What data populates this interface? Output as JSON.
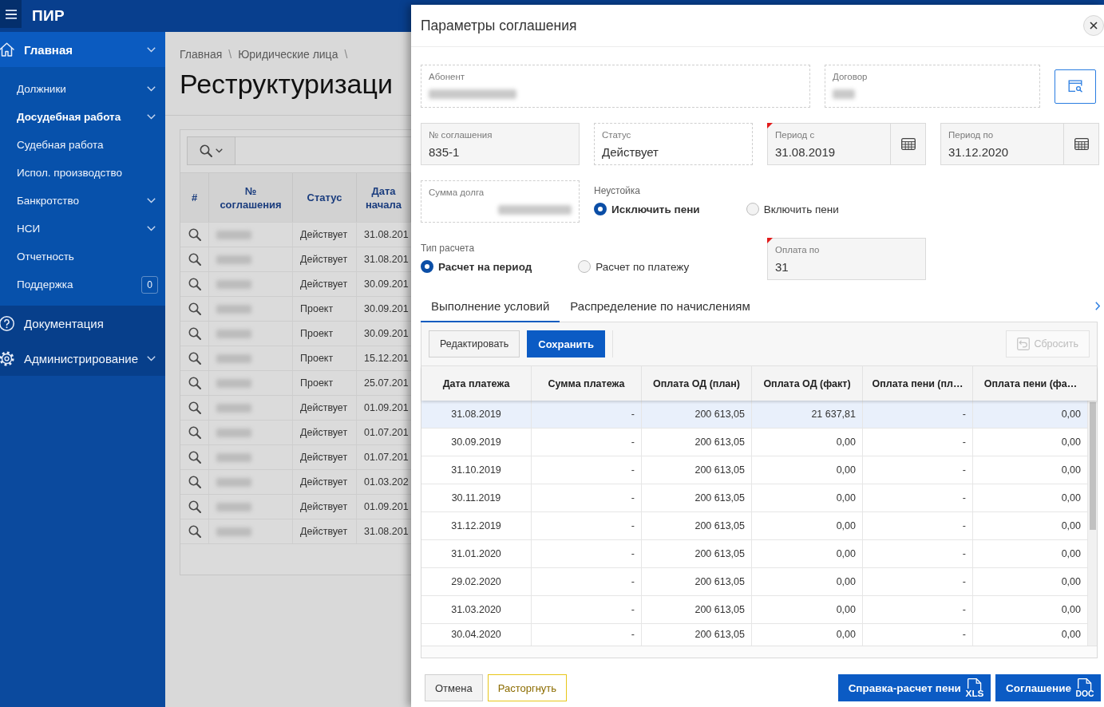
{
  "header": {
    "app_title": "ПИР"
  },
  "sidebar": {
    "home": {
      "label": "Главная",
      "selected": true,
      "expanded": true,
      "has_submenu": true,
      "children": [
        {
          "label": "Должники",
          "selected": false,
          "has_submenu": true
        },
        {
          "label": "Досудебная работа",
          "selected": true,
          "has_submenu": true
        },
        {
          "label": "Судебная работа",
          "selected": false,
          "has_submenu": false
        },
        {
          "label": "Испол. производство",
          "selected": false,
          "has_submenu": false
        },
        {
          "label": "Банкротство",
          "selected": false,
          "has_submenu": true
        },
        {
          "label": "НСИ",
          "selected": false,
          "has_submenu": true
        },
        {
          "label": "Отчетность",
          "selected": false,
          "has_submenu": false
        },
        {
          "label": "Поддержка",
          "selected": false,
          "has_submenu": false,
          "badge": "0"
        }
      ]
    },
    "documentation": {
      "label": "Документация",
      "selected": false
    },
    "administration": {
      "label": "Администрирование",
      "selected": false,
      "has_submenu": true
    }
  },
  "page": {
    "breadcrumb": [
      {
        "label": "Главная",
        "separator": "\\"
      },
      {
        "label": "Юридические лица",
        "separator": "\\"
      }
    ],
    "title": "Реструктуризаци",
    "table": {
      "columns": [
        "#",
        "№ соглашения",
        "Статус",
        "Дата начала"
      ],
      "rows": [
        {
          "status": "Действует",
          "start_date": "31.08.201"
        },
        {
          "status": "Действует",
          "start_date": "31.08.201"
        },
        {
          "status": "Действует",
          "start_date": "30.09.201"
        },
        {
          "status": "Проект",
          "start_date": "30.09.201"
        },
        {
          "status": "Проект",
          "start_date": "30.09.201"
        },
        {
          "status": "Проект",
          "start_date": "15.12.201"
        },
        {
          "status": "Проект",
          "start_date": "25.07.201"
        },
        {
          "status": "Действует",
          "start_date": "01.09.201"
        },
        {
          "status": "Действует",
          "start_date": "01.07.201"
        },
        {
          "status": "Действует",
          "start_date": "01.07.201"
        },
        {
          "status": "Действует",
          "start_date": "01.03.202"
        },
        {
          "status": "Действует",
          "start_date": "01.09.201"
        },
        {
          "status": "Действует",
          "start_date": "31.08.201"
        }
      ]
    }
  },
  "dialog": {
    "title": "Параметры соглашения",
    "form": [
      [
        {
          "kind": "readonly",
          "label": "Абонент",
          "blurred": true,
          "required": false
        },
        {
          "kind": "readonly",
          "label": "Договор",
          "blurred": true,
          "required": false
        },
        {
          "kind": "lookup_button"
        }
      ],
      [
        {
          "kind": "input",
          "label": "№ соглашения",
          "value": "835-1",
          "required": false
        },
        {
          "kind": "readonly",
          "label": "Статус",
          "value": "Действует",
          "blurred": false,
          "required": false
        },
        {
          "kind": "date",
          "label": "Период с",
          "value": "31.08.2019",
          "required": true
        },
        {
          "kind": "date",
          "label": "Период по",
          "value": "31.12.2020",
          "required": false
        }
      ],
      [
        {
          "kind": "amount",
          "label": "Сумма долга",
          "blurred": true,
          "required": false
        },
        {
          "kind": "radio_group",
          "label": "Неустойка",
          "options": [
            {
              "label": "Исключить пени",
              "selected": true
            },
            {
              "label": "Включить пени",
              "selected": false
            }
          ]
        }
      ],
      [
        {
          "kind": "radio_group",
          "label": "Тип расчета",
          "options": [
            {
              "label": "Расчет на период",
              "selected": true
            },
            {
              "label": "Расчет по платежу",
              "selected": false
            }
          ]
        },
        {
          "kind": "input",
          "label": "Оплата по",
          "value": "31",
          "required": true
        }
      ]
    ],
    "tabs": [
      {
        "label": "Выполнение условий",
        "selected": true
      },
      {
        "label": "Распределение по начислениям",
        "selected": false
      }
    ],
    "grid": {
      "toolbar": [
        {
          "label": "Редактировать",
          "kind": "default",
          "disabled": false
        },
        {
          "label": "Сохранить",
          "kind": "primary",
          "disabled": false
        },
        {
          "label": "Сбросить",
          "kind": "reset",
          "disabled": true
        }
      ],
      "columns": [
        "Дата платежа",
        "Сумма платежа",
        "Оплата ОД (план)",
        "Оплата ОД (факт)",
        "Оплата пени (пл…",
        "Оплата пени (фа…"
      ],
      "rows": [
        {
          "selected": true,
          "cells": [
            "31.08.2019",
            "-",
            "200 613,05",
            "21 637,81",
            "-",
            "0,00"
          ]
        },
        {
          "selected": false,
          "cells": [
            "30.09.2019",
            "-",
            "200 613,05",
            "0,00",
            "-",
            "0,00"
          ]
        },
        {
          "selected": false,
          "cells": [
            "31.10.2019",
            "-",
            "200 613,05",
            "0,00",
            "-",
            "0,00"
          ]
        },
        {
          "selected": false,
          "cells": [
            "30.11.2019",
            "-",
            "200 613,05",
            "0,00",
            "-",
            "0,00"
          ]
        },
        {
          "selected": false,
          "cells": [
            "31.12.2019",
            "-",
            "200 613,05",
            "0,00",
            "-",
            "0,00"
          ]
        },
        {
          "selected": false,
          "cells": [
            "31.01.2020",
            "-",
            "200 613,05",
            "0,00",
            "-",
            "0,00"
          ]
        },
        {
          "selected": false,
          "cells": [
            "29.02.2020",
            "-",
            "200 613,05",
            "0,00",
            "-",
            "0,00"
          ]
        },
        {
          "selected": false,
          "cells": [
            "31.03.2020",
            "-",
            "200 613,05",
            "0,00",
            "-",
            "0,00"
          ]
        },
        {
          "selected": false,
          "cells": [
            "30.04.2020",
            "-",
            "200 613,05",
            "0,00",
            "-",
            "0,00"
          ]
        }
      ]
    },
    "footer": {
      "left": [
        {
          "label": "Отмена",
          "kind": "default"
        },
        {
          "label": "Расторгнуть",
          "kind": "warning"
        }
      ],
      "right": [
        {
          "label": "Справка-расчет пени",
          "kind": "primary",
          "file_type": "XLS"
        },
        {
          "label": "Соглашение",
          "kind": "primary",
          "file_type": "DOC"
        }
      ]
    }
  }
}
